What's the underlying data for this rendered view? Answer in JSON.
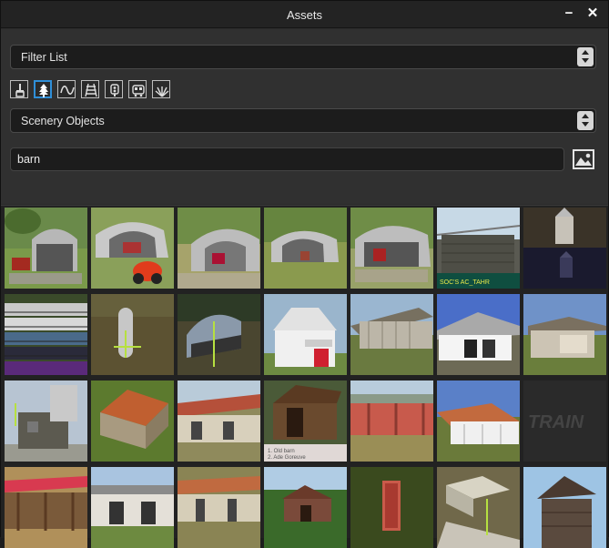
{
  "window": {
    "title": "Assets"
  },
  "controls": {
    "minimize": "−",
    "close": "✕"
  },
  "filter": {
    "label": "Filter List"
  },
  "icons": [
    {
      "name": "paint-brush-icon",
      "active": false
    },
    {
      "name": "tree-icon",
      "active": true
    },
    {
      "name": "spline-icon",
      "active": false
    },
    {
      "name": "track-icon",
      "active": false
    },
    {
      "name": "signal-icon",
      "active": false
    },
    {
      "name": "train-icon",
      "active": false
    },
    {
      "name": "grass-icon",
      "active": false
    }
  ],
  "category": {
    "label": "Scenery Objects"
  },
  "search": {
    "value": "barn"
  },
  "thumb_overlay_text": {
    "r0c5": "SOC'S AC_TAHR",
    "r2c3a": "1. Old barn",
    "r2c3b": "2. Ade Goreuve",
    "r2c6": "TRAIN"
  },
  "colors": {
    "accent": "#2f8fd8",
    "background": "#2b2b2b"
  }
}
